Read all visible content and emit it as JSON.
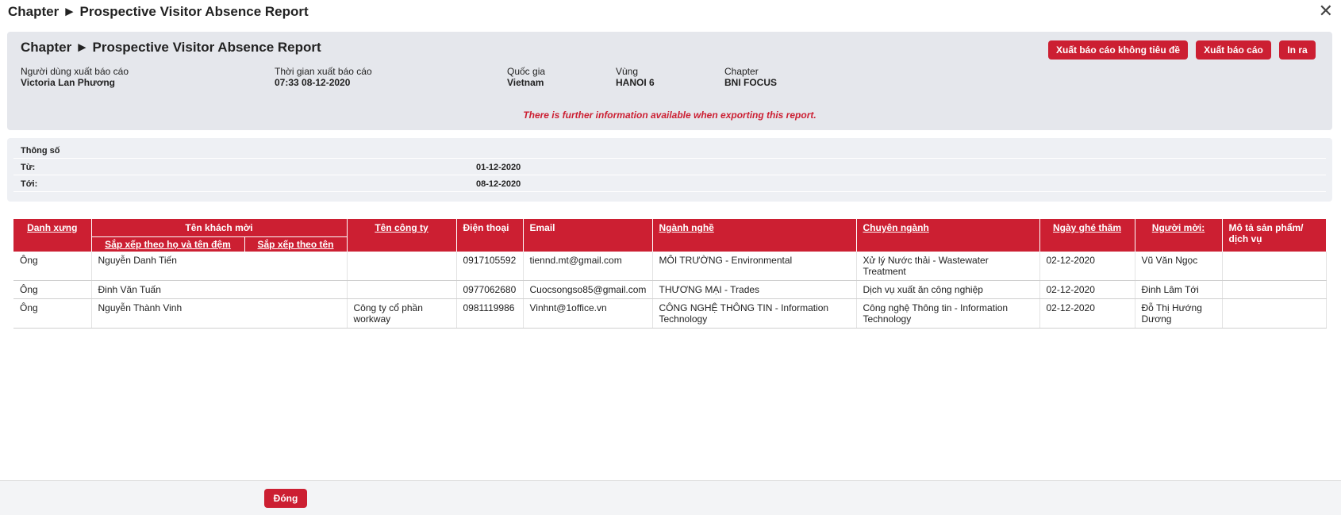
{
  "window": {
    "title": "Chapter ► Prospective Visitor Absence Report"
  },
  "header": {
    "title": "Chapter ► Prospective Visitor Absence Report",
    "buttons": {
      "export_untitled": "Xuất báo cáo không tiêu đề",
      "export": "Xuất báo cáo",
      "print": "In ra"
    },
    "meta": {
      "user_label": "Người dùng xuất báo cáo",
      "user_value": "Victoria Lan Phương",
      "time_label": "Thời gian xuất báo cáo",
      "time_value": "07:33 08-12-2020",
      "country_label": "Quốc gia",
      "country_value": "Vietnam",
      "region_label": "Vùng",
      "region_value": "HANOI 6",
      "chapter_label": "Chapter",
      "chapter_value": "BNI FOCUS"
    },
    "notice": "There is further information available when exporting this report."
  },
  "params": {
    "title": "Thông số",
    "from_label": "Từ:",
    "from_value": "01-12-2020",
    "to_label": "Tới:",
    "to_value": "08-12-2020"
  },
  "table": {
    "headers": {
      "salutation": "Danh xưng",
      "guest_name": "Tên khách mời",
      "sort_lastname": "Sắp xếp theo họ và tên đệm",
      "sort_firstname": "Sắp xếp theo tên",
      "company": "Tên công ty",
      "phone": "Điện thoại",
      "email": "Email",
      "profession": "Ngành nghề",
      "specialty": "Chuyên ngành",
      "visit_date": "Ngày ghé thăm",
      "invited_by": "Người mời:",
      "description": "Mô tả sản phẩm/ dịch vụ"
    },
    "rows": [
      {
        "salutation": "Ông",
        "name": "Nguyễn Danh Tiến",
        "company": "",
        "phone": "0917105592",
        "email": "tiennd.mt@gmail.com",
        "profession": "MÔI TRƯỜNG - Environmental",
        "specialty": "Xử lý Nước thải - Wastewater Treatment",
        "visit_date": "02-12-2020",
        "invited_by": "Vũ Văn Ngọc",
        "description": ""
      },
      {
        "salutation": "Ông",
        "name": "Đinh Văn Tuấn",
        "company": "",
        "phone": "0977062680",
        "email": "Cuocsongso85@gmail.com",
        "profession": "THƯƠNG MẠI - Trades",
        "specialty": "Dịch vụ xuất ăn công nghiệp",
        "visit_date": "02-12-2020",
        "invited_by": "Đinh Lâm Tới",
        "description": ""
      },
      {
        "salutation": "Ông",
        "name": "Nguyễn Thành Vinh",
        "company": "Công ty cổ phần workway",
        "phone": "0981119986",
        "email": "Vinhnt@1office.vn",
        "profession": "CÔNG NGHỆ THÔNG TIN - Information Technology",
        "specialty": "Công nghệ Thông tin - Information Technology",
        "visit_date": "02-12-2020",
        "invited_by": "Đỗ Thị Hướng Dương",
        "description": ""
      }
    ]
  },
  "footer": {
    "close_label": "Đóng"
  },
  "colors": {
    "accent": "#cc1f32",
    "panel": "#e5e7ec"
  }
}
